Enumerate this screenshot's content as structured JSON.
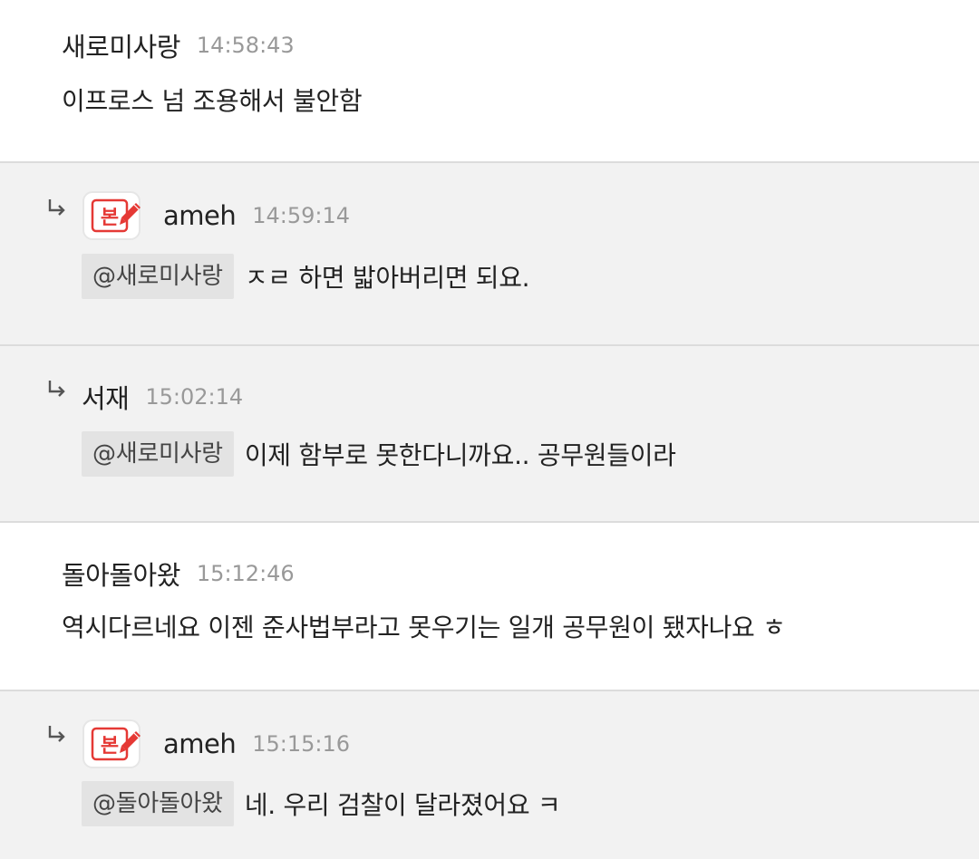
{
  "comments": [
    {
      "type": "top",
      "author": "새로미사랑",
      "time": "14:58:43",
      "text": "이프로스 넘 조용해서 불안함"
    },
    {
      "type": "reply",
      "author": "ameh",
      "badge_text": "본",
      "time": "14:59:14",
      "mention": "@새로미사랑",
      "text": "ㅈㄹ 하면 밟아버리면 되요."
    },
    {
      "type": "reply",
      "author": "서재",
      "time": "15:02:14",
      "mention": "@새로미사랑",
      "text": "이제 함부로 못한다니까요.. 공무원들이라"
    },
    {
      "type": "top",
      "author": "돌아돌아왔",
      "time": "15:12:46",
      "text": "역시다르네요 이젠 준사법부라고 못우기는 일개 공무원이 됐자나요 ㅎ"
    },
    {
      "type": "reply",
      "author": "ameh",
      "badge_text": "본",
      "time": "15:15:16",
      "mention": "@돌아돌아왔",
      "text": "네. 우리 검찰이 달라졌어요 ㅋ"
    }
  ],
  "colors": {
    "reply_background": "#f2f2f2",
    "mention_background": "#e3e3e3",
    "time_text": "#999999",
    "badge_red": "#e53935",
    "divider": "#dcdcdc"
  },
  "icons": {
    "reply_arrow": "reply-arrow-icon",
    "badge": "author-badge-icon",
    "pencil": "pencil-icon"
  }
}
